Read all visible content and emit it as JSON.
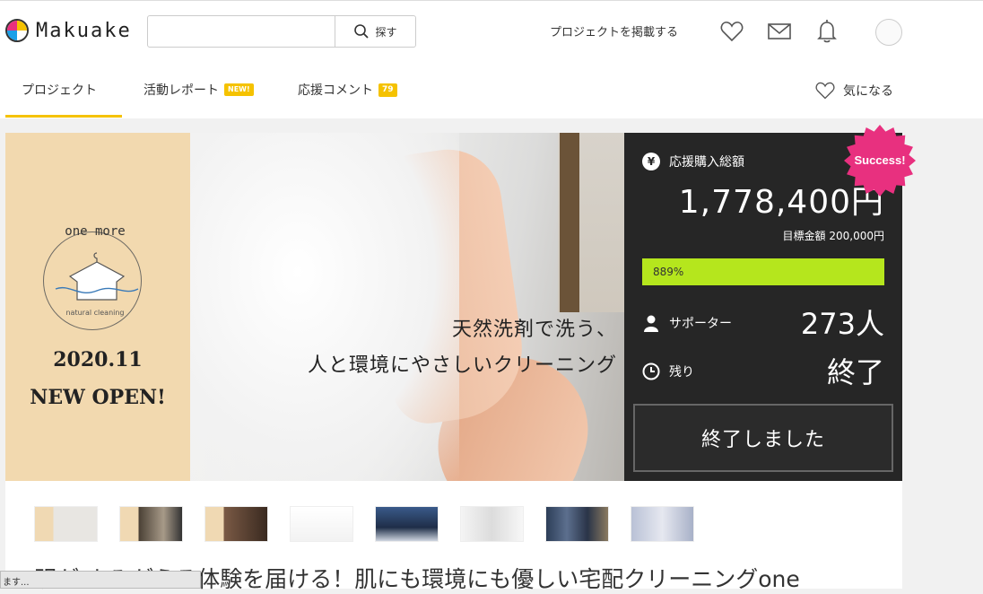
{
  "header": {
    "logo_text": "Makuake",
    "search_placeholder": "",
    "search_label": "探す",
    "post_project": "プロジェクトを掲載する"
  },
  "tabs": {
    "items": [
      {
        "label": "プロジェクト"
      },
      {
        "label": "活動レポート",
        "badge": "NEW!"
      },
      {
        "label": "応援コメント",
        "badge": "79"
      }
    ],
    "favorite": "気になる"
  },
  "hero": {
    "brand_top": "one more",
    "brand_bottom": "natural cleaning",
    "open_date": "2020.11",
    "open_text": "NEW OPEN!",
    "tagline_1": "天然洗剤で洗う、",
    "tagline_2": "人と環境にやさしいクリーニング"
  },
  "panel": {
    "total_label": "応援購入総額",
    "total_value": "1,778,400円",
    "goal_text": "目標金額 200,000円",
    "progress_pct": 889,
    "progress_label": "889%",
    "supporters_label": "サポーター",
    "supporters_value": "273人",
    "remaining_label": "残り",
    "remaining_value": "終了",
    "ended_button": "終了しました",
    "success_badge": "Success!"
  },
  "colors": {
    "accent": "#f5c200",
    "progress": "#b5e61d",
    "panel_bg": "#262626",
    "success": "#e8307f"
  },
  "content": {
    "title": "明が よみがえる体験を届ける！肌にも環境にも優しい宅配クリーニングone"
  },
  "statusbar": {
    "text": "ます..."
  }
}
